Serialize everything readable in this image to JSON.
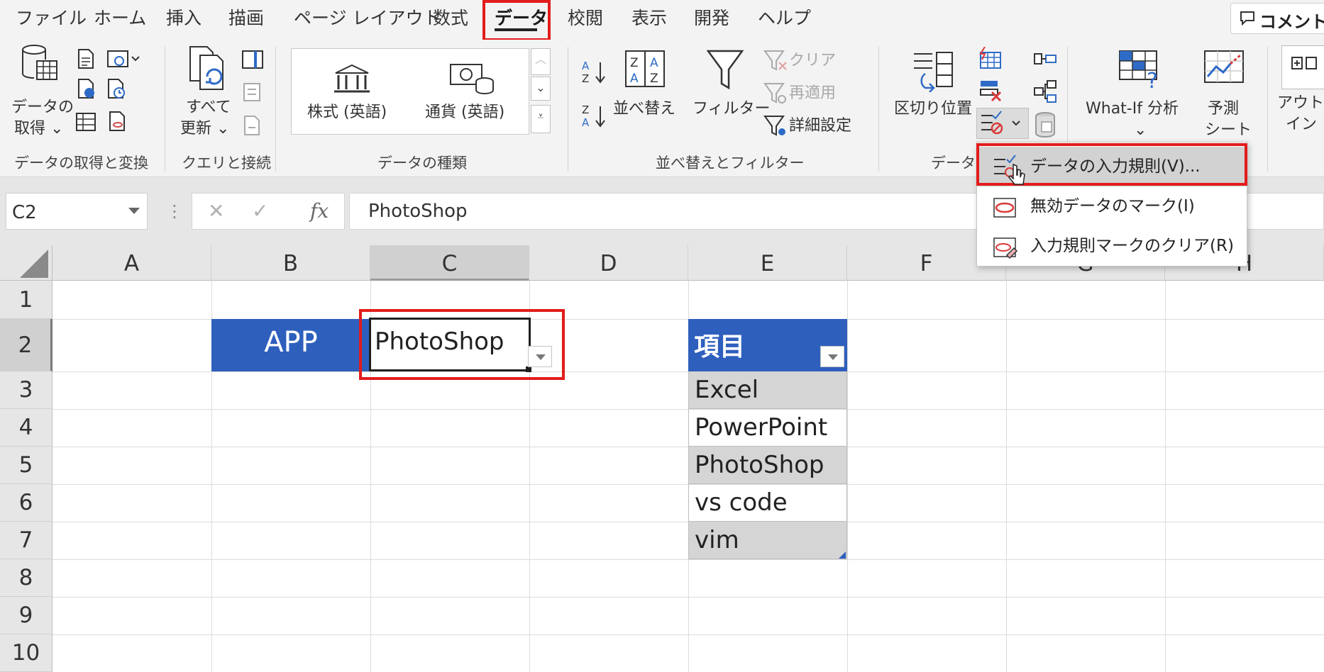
{
  "menubar": {
    "tabs": [
      "ファイル",
      "ホーム",
      "挿入",
      "描画",
      "ページ レイアウト",
      "数式",
      "データ",
      "校閲",
      "表示",
      "開発",
      "ヘルプ"
    ],
    "active_tab": "データ",
    "comment_label": "コメント"
  },
  "ribbon": {
    "get_data": {
      "label_line1": "データの",
      "label_line2": "取得 ⌄",
      "group_label": "データの取得と変換"
    },
    "queries": {
      "refresh_line1": "すべて",
      "refresh_line2": "更新 ⌄",
      "group_label": "クエリと接続"
    },
    "data_types": {
      "stocks_label": "株式 (英語)",
      "currency_label": "通貨 (英語)",
      "group_label": "データの種類"
    },
    "sort_filter": {
      "sort_label": "並べ替え",
      "filter_label": "フィルター",
      "clear_label": "クリア",
      "reapply_label": "再適用",
      "advanced_label": "詳細設定",
      "group_label": "並べ替えとフィルター"
    },
    "data_tools": {
      "text_to_columns_label": "区切り位置",
      "group_label": "データ"
    },
    "forecast": {
      "whatif_label": "What-If 分析",
      "whatif_arrow": "⌄",
      "forecast_line1": "予測",
      "forecast_line2": "シート"
    },
    "outline": {
      "label_line1": "アウトラ",
      "label_line2": "イン ⌄"
    }
  },
  "formula_bar": {
    "name_box": "C2",
    "cancel_glyph": "✕",
    "enter_glyph": "✓",
    "fx_label": "fx",
    "formula": "PhotoShop"
  },
  "grid": {
    "columns": [
      "A",
      "B",
      "C",
      "D",
      "E",
      "F",
      "G",
      "H"
    ],
    "rows": [
      "1",
      "2",
      "3",
      "4",
      "5",
      "6",
      "7",
      "8",
      "9",
      "10"
    ],
    "b2": "APP",
    "c2": "PhotoShop",
    "e2_header": "項目",
    "list": [
      "Excel",
      "PowerPoint",
      "PhotoShop",
      "vs code",
      "vim"
    ]
  },
  "dropdown_menu": {
    "items": [
      "データの入力規則(V)...",
      "無効データのマーク(I)",
      "入力規則マークのクリア(R)"
    ]
  },
  "colors": {
    "accent_blue": "#2e5fbd",
    "highlight_red": "#e21c1c",
    "ribbon_bg": "#f3f3f3"
  }
}
